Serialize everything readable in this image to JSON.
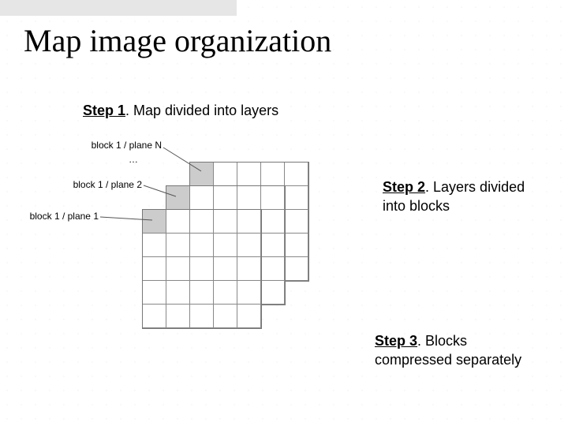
{
  "title": "Map image organization",
  "steps": {
    "s1": {
      "label": "Step 1",
      "text": ". Map divided into layers"
    },
    "s2": {
      "label": "Step 2",
      "text": ". Layers divided into blocks"
    },
    "s3": {
      "label": "Step 3",
      "text": ". Blocks compressed separately"
    }
  },
  "diagram": {
    "labels": {
      "top": "block 1 / plane N",
      "dots": "…",
      "mid": "block 1 / plane 2",
      "bottom": "block 1 / plane 1"
    },
    "planes": 3,
    "grid_cells": 5
  }
}
